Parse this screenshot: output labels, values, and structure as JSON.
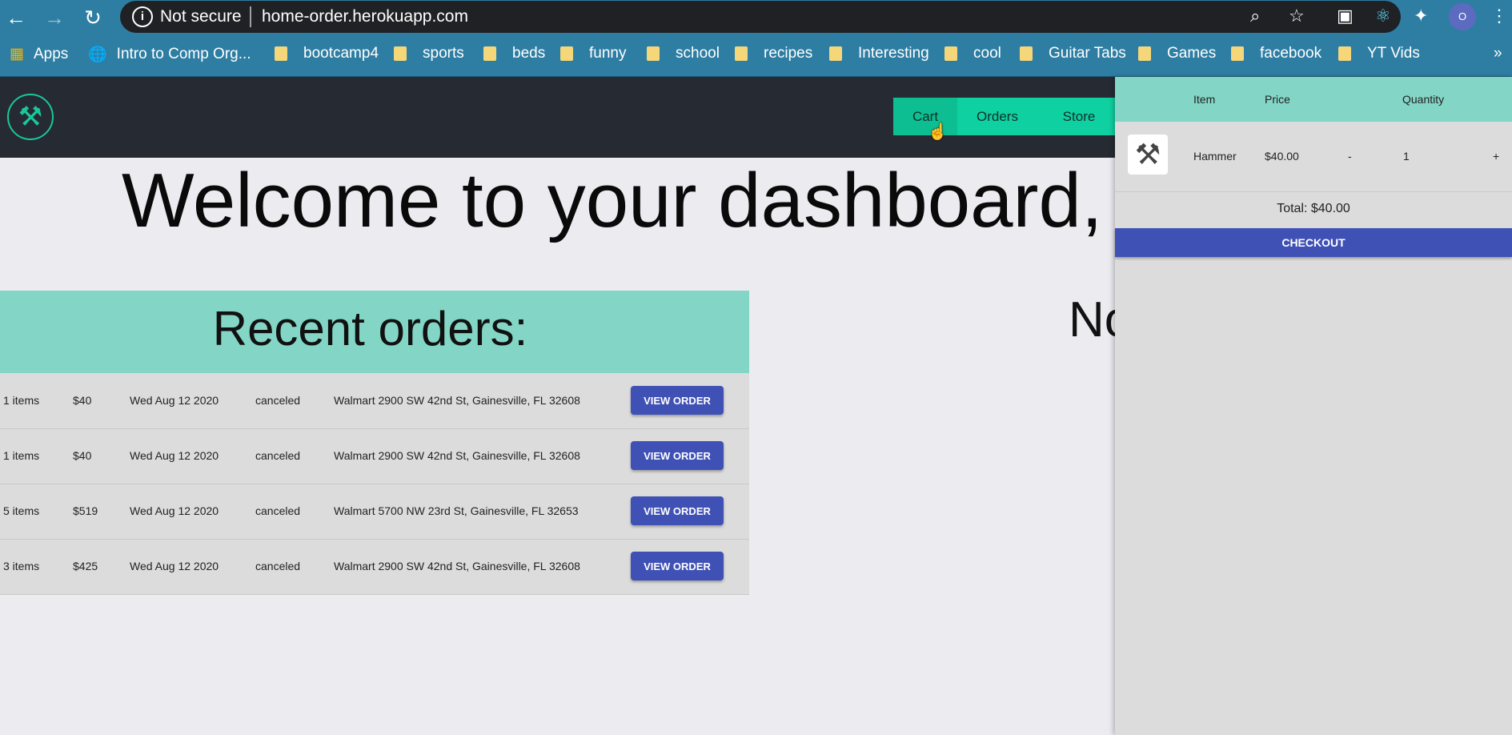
{
  "browser": {
    "security_label": "Not secure",
    "url": "home-order.herokuapp.com",
    "profile_initial": "O",
    "bookmarks": [
      "Apps",
      "Intro to Comp Org...",
      "bootcamp4",
      "sports",
      "beds",
      "funny",
      "school",
      "recipes",
      "Interesting",
      "cool",
      "Guitar Tabs",
      "Games",
      "facebook",
      "YT Vids"
    ],
    "more_bookmarks": "»"
  },
  "nav": {
    "cart": "Cart",
    "orders": "Orders",
    "store": "Store"
  },
  "welcome_text": "Welcome to your dashboard, cu",
  "right_partial_text": "No",
  "orders": {
    "title": "Recent orders:",
    "button_label": "VIEW ORDER",
    "rows": [
      {
        "items": "1 items",
        "price": "$40",
        "date": "Wed Aug 12 2020",
        "status": "canceled",
        "address": "Walmart 2900 SW 42nd St, Gainesville, FL 32608"
      },
      {
        "items": "1 items",
        "price": "$40",
        "date": "Wed Aug 12 2020",
        "status": "canceled",
        "address": "Walmart 2900 SW 42nd St, Gainesville, FL 32608"
      },
      {
        "items": "5 items",
        "price": "$519",
        "date": "Wed Aug 12 2020",
        "status": "canceled",
        "address": "Walmart 5700 NW 23rd St, Gainesville, FL 32653"
      },
      {
        "items": "3 items",
        "price": "$425",
        "date": "Wed Aug 12 2020",
        "status": "canceled",
        "address": "Walmart 2900 SW 42nd St, Gainesville, FL 32608"
      }
    ]
  },
  "cart": {
    "headers": {
      "item": "Item",
      "price": "Price",
      "quantity": "Quantity"
    },
    "item": {
      "name": "Hammer",
      "price": "$40.00",
      "decrement": "-",
      "quantity": "1",
      "increment": "+"
    },
    "total": "Total: $40.00",
    "checkout_label": "CHECKOUT"
  },
  "colors": {
    "accent_teal": "#0fd0a1",
    "header_teal": "#83d6c6",
    "button_indigo": "#3f51b5",
    "app_header_dark": "#262a33"
  }
}
